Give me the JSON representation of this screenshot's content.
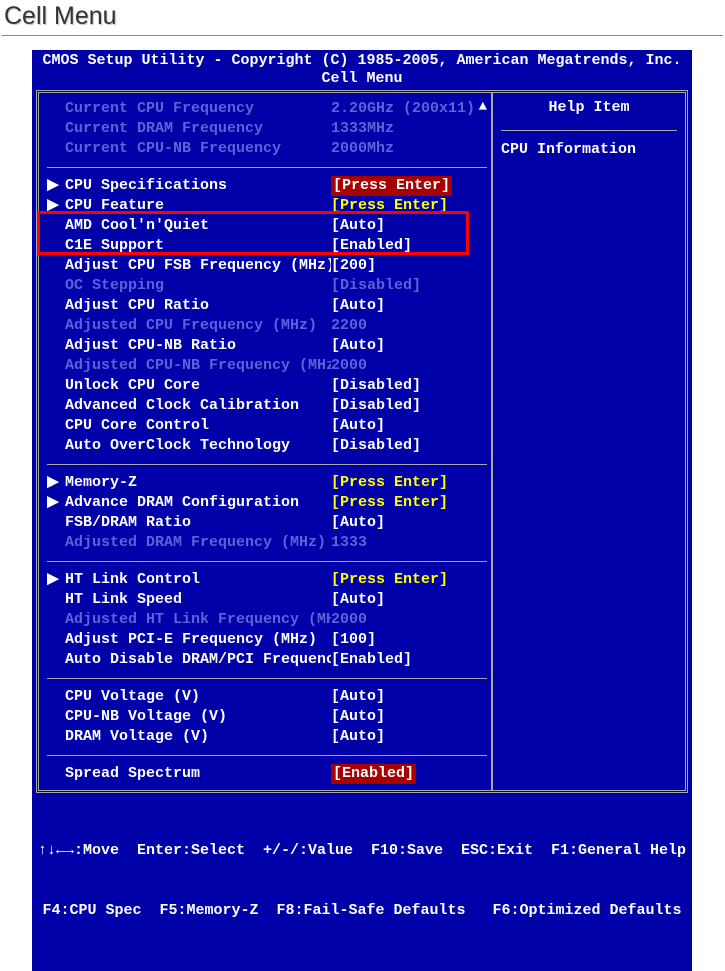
{
  "page_heading": "Cell Menu",
  "header": {
    "line1": "CMOS Setup Utility - Copyright (C) 1985-2005, American Megatrends, Inc.",
    "line2": "Cell Menu"
  },
  "help": {
    "title": "Help Item",
    "body": "CPU Information"
  },
  "info_rows": [
    {
      "label": "Current CPU Frequency",
      "value": "2.20GHz (200x11)"
    },
    {
      "label": "Current DRAM Frequency",
      "value": "1333MHz"
    },
    {
      "label": "Current CPU-NB Frequency",
      "value": "2000Mhz"
    }
  ],
  "sections": [
    [
      {
        "label": "CPU Specifications",
        "value": "[Press Enter]",
        "arrow": true,
        "vstyle": "redbox"
      },
      {
        "label": "CPU Feature",
        "value": "[Press Enter]",
        "arrow": true,
        "vstyle": "yellow"
      },
      {
        "label": "AMD Cool'n'Quiet",
        "value": "[Auto]",
        "arrow": false,
        "vstyle": "white"
      },
      {
        "label": "C1E Support",
        "value": "[Enabled]",
        "arrow": false,
        "vstyle": "white"
      },
      {
        "label": "Adjust CPU FSB Frequency (MHz)",
        "value": "[200]",
        "arrow": false,
        "vstyle": "white"
      },
      {
        "label": "OC Stepping",
        "value": "[Disabled]",
        "arrow": false,
        "vstyle": "white",
        "dim": true
      },
      {
        "label": "Adjust CPU Ratio",
        "value": "[Auto]",
        "arrow": false,
        "vstyle": "white"
      },
      {
        "label": "Adjusted CPU Frequency (MHz)",
        "value": "2200",
        "arrow": false,
        "vstyle": "white",
        "dim": true
      },
      {
        "label": "Adjust CPU-NB Ratio",
        "value": "[Auto]",
        "arrow": false,
        "vstyle": "white"
      },
      {
        "label": "Adjusted CPU-NB Frequency (MHz)",
        "value": "2000",
        "arrow": false,
        "vstyle": "white",
        "dim": true
      },
      {
        "label": "Unlock CPU Core",
        "value": "[Disabled]",
        "arrow": false,
        "vstyle": "white"
      },
      {
        "label": "Advanced Clock Calibration",
        "value": "[Disabled]",
        "arrow": false,
        "vstyle": "white"
      },
      {
        "label": "CPU Core Control",
        "value": "[Auto]",
        "arrow": false,
        "vstyle": "white"
      },
      {
        "label": "Auto OverClock Technology",
        "value": "[Disabled]",
        "arrow": false,
        "vstyle": "white"
      }
    ],
    [
      {
        "label": "Memory-Z",
        "value": "[Press Enter]",
        "arrow": true,
        "vstyle": "yellow"
      },
      {
        "label": "Advance DRAM Configuration",
        "value": "[Press Enter]",
        "arrow": true,
        "vstyle": "yellow"
      },
      {
        "label": "FSB/DRAM Ratio",
        "value": "[Auto]",
        "arrow": false,
        "vstyle": "white"
      },
      {
        "label": "Adjusted DRAM Frequency (MHz)",
        "value": "1333",
        "arrow": false,
        "vstyle": "white",
        "dim": true
      }
    ],
    [
      {
        "label": "HT Link Control",
        "value": "[Press Enter]",
        "arrow": true,
        "vstyle": "yellow"
      },
      {
        "label": "HT Link Speed",
        "value": "[Auto]",
        "arrow": false,
        "vstyle": "white"
      },
      {
        "label": "Adjusted HT Link Frequency (MHz)",
        "value": "2000",
        "arrow": false,
        "vstyle": "white",
        "dim": true
      },
      {
        "label": "Adjust PCI-E Frequency (MHz)",
        "value": "[100]",
        "arrow": false,
        "vstyle": "white"
      },
      {
        "label": "Auto Disable DRAM/PCI Frequency",
        "value": "[Enabled]",
        "arrow": false,
        "vstyle": "white"
      }
    ],
    [
      {
        "label": "CPU Voltage (V)",
        "value": "[Auto]",
        "arrow": false,
        "vstyle": "white"
      },
      {
        "label": "CPU-NB Voltage (V)",
        "value": "[Auto]",
        "arrow": false,
        "vstyle": "white"
      },
      {
        "label": "DRAM Voltage (V)",
        "value": "[Auto]",
        "arrow": false,
        "vstyle": "white"
      }
    ],
    [
      {
        "label": "Spread Spectrum",
        "value": "[Enabled]",
        "arrow": false,
        "vstyle": "redbox"
      }
    ]
  ],
  "footer": {
    "line1": "↑↓←→:Move  Enter:Select  +/-/:Value  F10:Save  ESC:Exit  F1:General Help",
    "line2": "F4:CPU Spec  F5:Memory-Z  F8:Fail-Safe Defaults   F6:Optimized Defaults"
  },
  "scroll_glyph": "▲"
}
